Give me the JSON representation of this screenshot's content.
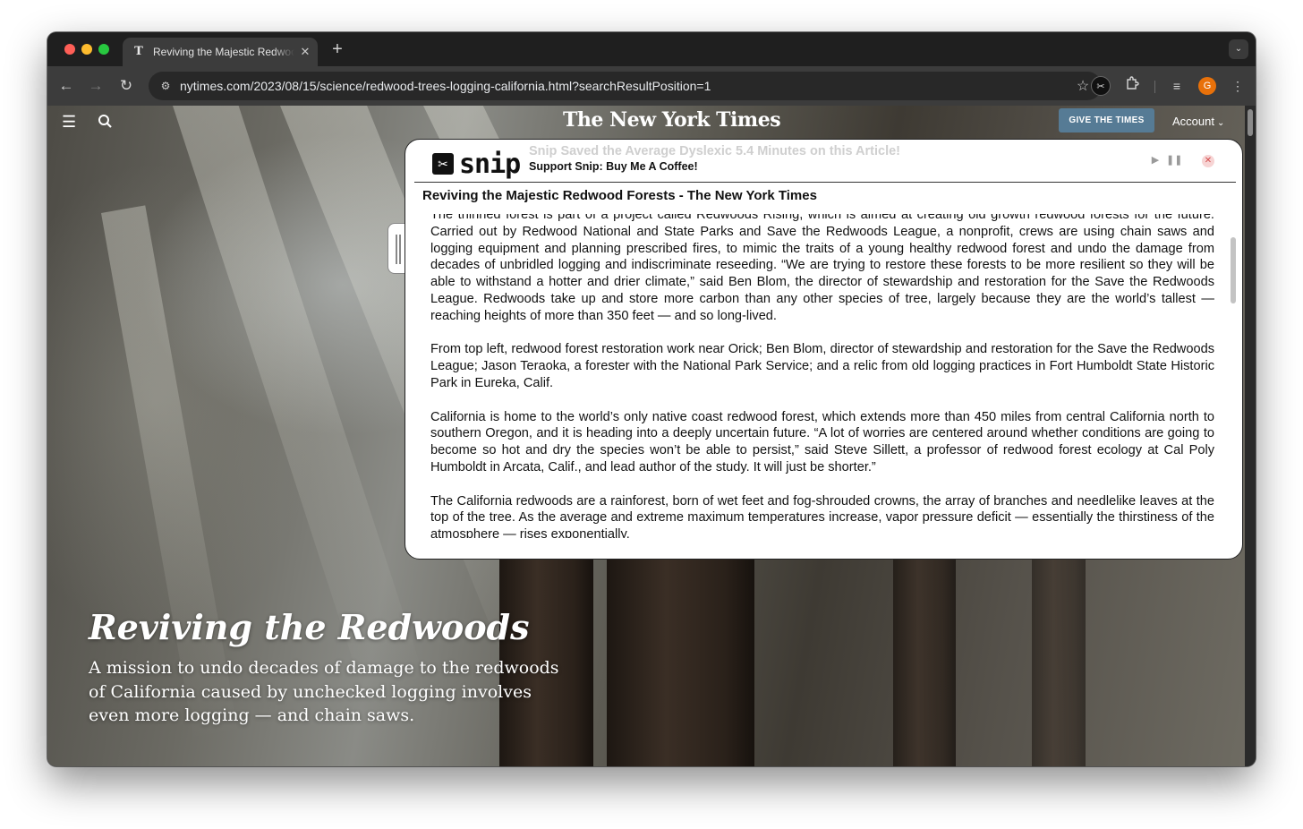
{
  "browser": {
    "tab_title": "Reviving the Majestic Redwood Forests - The New York Times",
    "tab_favicon": "T",
    "new_tab": "+",
    "url": "nytimes.com/2023/08/15/science/redwood-trees-logging-california.html?searchResultPosition=1",
    "profile_initial": "G",
    "icons": [
      "back-icon",
      "forward-icon",
      "reload-icon",
      "site-info-icon",
      "star-icon",
      "snip-extension-icon",
      "extensions-puzzle-icon",
      "media-controls-icon",
      "more-menu-icon",
      "tab-search-icon"
    ]
  },
  "nyt": {
    "logo": "The New York Times",
    "give_button": "GIVE THE TIMES",
    "account": "Account",
    "hero_title": "Reviving the Redwoods",
    "hero_subtitle": "A mission to undo decades of damage to the redwoods of California caused by unchecked logging involves even more logging — and chain saws."
  },
  "snip": {
    "logo": "snip",
    "saved_message": "Snip Saved the Average Dyslexic 5.4 Minutes on this Article!",
    "support": "Support Snip: Buy Me A Coffee!",
    "article_title": "Reviving the Majestic Redwood Forests - The New York Times",
    "paragraphs": [
      "The thinned forest is part of a project called Redwoods Rising, which is aimed at creating old growth redwood forests for the future. Carried out by Redwood National and State Parks and Save the Redwoods League, a nonprofit, crews are using chain saws and logging equipment and planning prescribed fires, to mimic the traits of a young healthy redwood forest and undo the damage from decades of unbridled logging and indiscriminate reseeding. “We are trying to restore these forests to be more resilient so they will be able to withstand a hotter and drier climate,” said Ben Blom, the director of stewardship and restoration for the Save the Redwoods League. Redwoods take up and store more carbon than any other species of tree, largely because they are the world’s tallest — reaching heights of more than 350 feet — and so long-lived.",
      "From top left, redwood forest restoration work near Orick; Ben Blom, director of stewardship and restoration for the Save the Redwoods League; Jason Teraoka, a forester with the National Park Service; and a relic from old logging practices in Fort Humboldt State Historic Park in Eureka, Calif.",
      "California is home to the world’s only native coast redwood forest, which extends more than 450 miles from central California north to southern Oregon, and it is heading into a deeply uncertain future. “A lot of worries are centered around whether conditions are going to become so hot and dry the species won’t be able to persist,” said Steve Sillett, a professor of redwood forest ecology at Cal Poly Humboldt in Arcata, Calif., and lead author of the study. It will just be shorter.”",
      "The California redwoods are a rainforest, born of wet feet and fog-shrouded crowns, the array of branches and needlelike leaves at the top of the tree. As the average and extreme maximum temperatures increase, vapor pressure deficit — essentially the thirstiness of the atmosphere — rises exponentially."
    ]
  }
}
